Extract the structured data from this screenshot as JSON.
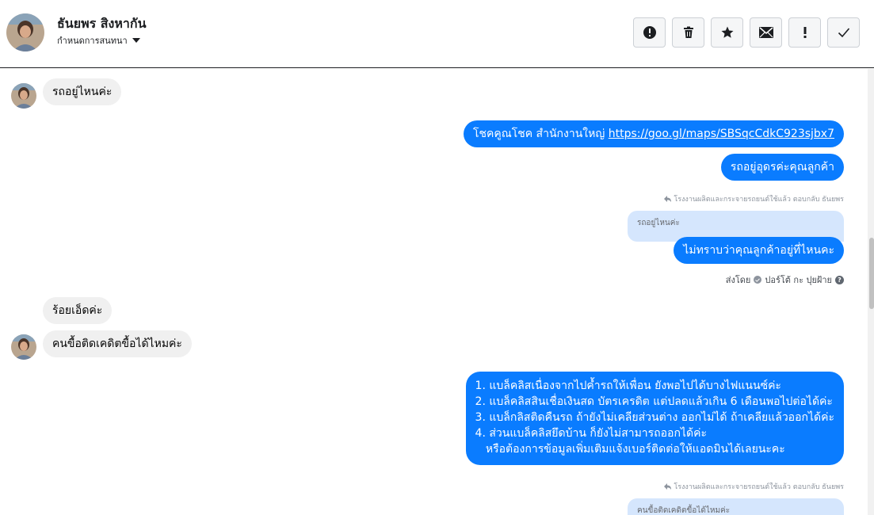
{
  "header": {
    "contact_name": "ธันยพร สิงหากัน",
    "assign_label": "กำหนดการสนทนา"
  },
  "toolbar": {
    "buttons": [
      {
        "name": "report-spam-button",
        "icon": "alert-circle-icon"
      },
      {
        "name": "delete-button",
        "icon": "trash-icon"
      },
      {
        "name": "star-button",
        "icon": "star-icon"
      },
      {
        "name": "mark-unread-button",
        "icon": "envelope-icon"
      },
      {
        "name": "mark-important-button",
        "icon": "exclamation-icon"
      },
      {
        "name": "mark-done-button",
        "icon": "check-icon"
      }
    ]
  },
  "colors": {
    "outgoing": "#0a7cff",
    "incoming": "#f0f0f0",
    "quote": "#d5e6fd"
  },
  "messages": {
    "m1": "รถอยู่ไหนค่ะ",
    "m2_prefix": "โชคคูณโชค สำนักงานใหญ่ ",
    "m2_link": "https://goo.gl/maps/SBSqcCdkC923sjbx7",
    "m3": "รถอยู่อุดรค่ะคุณลูกค้า",
    "reply_meta_1": "โรงงานผลิตและกระจายรถยนต์ใช้แล้ว ตอบกลับ ธันยพร",
    "quote_1": "รถอยู่ไหนค่ะ",
    "m4": "ไม่ทราบว่าคุณลูกค้าอยู่ที่ไหนคะ",
    "sent_by": "ส่งโดย",
    "sender_name": "ปอร์โต้ กะ ปุยฝ้าย",
    "m5": "ร้อยเอ็ดค่ะ",
    "m6": "คนขื้อติดเคดิตขื้อได้ไหมค่ะ",
    "m7_lines": [
      "1. แบล็คลิสเนื่องจากไปค้ำรถให้เพื่อน ยังพอไปได้บางไฟแนนซ์ค่ะ",
      "2. แบล็คลิสสินเชื่อเงินสด บัตรเครดิต แต่ปลดแล้วเกิน 6 เดือนพอไปต่อได้ค่ะ",
      "3. แบล็กลิสติดคืนรถ ถ้ายังไม่เคลียส่วนต่าง ออกไม่ได้ ถ้าเคลียแล้วออกได้ค่ะ",
      "4. ส่วนแบล็คลิสยึดบ้าน ก็ยังไม่สามารถออกได้ค่ะ",
      "   หรือต้องการข้อมูลเพิ่มเติมแจ้งเบอร์ติดต่อให้แอดมินได้เลยนะคะ"
    ],
    "reply_meta_2": "โรงงานผลิตและกระจายรถยนต์ใช้แล้ว ตอบกลับ ธันยพร",
    "quote_2": "คนขื้อติดเคดิตขื้อได้ไหมค่ะ"
  }
}
